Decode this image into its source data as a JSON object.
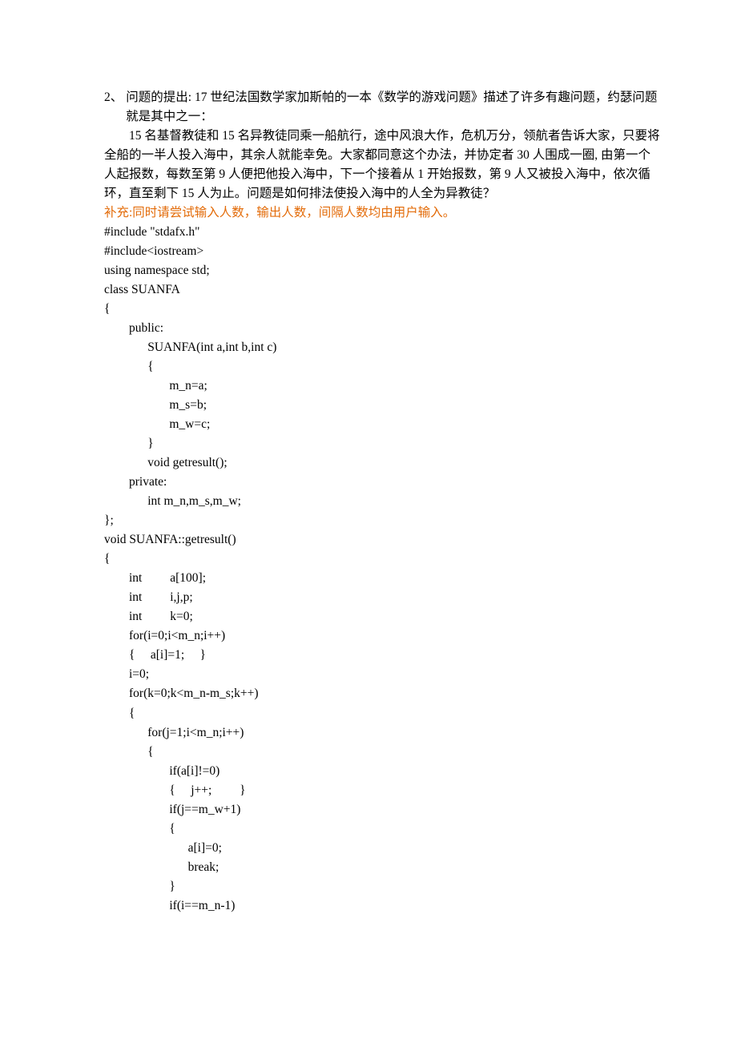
{
  "question_number": "2、",
  "title_line": "问题的提出: 17 世纪法国数学家加斯帕的一本《数学的游戏问题》描述了许多有趣问题，约瑟问题就是其中之一：",
  "para1": "15 名基督教徒和 15 名异教徒同乘一船航行，途中风浪大作，危机万分，领航者告诉大家，只要将全船的一半人投入海中，其余人就能幸免。大家都同意这个办法，并协定者 30 人围成一圈, 由第一个人起报数，每数至第 9 人便把他投入海中，下一个接着从 1 开始报数，第 9 人又被投入海中，依次循环，直至剩下 15 人为止。问题是如何排法使投入海中的人全为异教徒？",
  "supplement": "补充:同时请尝试输入人数，输出人数，间隔人数均由用户输入。",
  "code_lines": [
    "#include \"stdafx.h\"",
    "#include<iostream>",
    "using namespace std;",
    "class SUANFA",
    "{",
    "        public:",
    "              SUANFA(int a,int b,int c)",
    "              {",
    "                     m_n=a;",
    "                     m_s=b;",
    "                     m_w=c;",
    "              }",
    "              void getresult();",
    "        private:",
    "              int m_n,m_s,m_w;",
    "};",
    "void SUANFA::getresult()",
    "{",
    "        int         a[100];",
    "        int         i,j,p;",
    "        int         k=0;",
    "        for(i=0;i<m_n;i++)",
    "        {     a[i]=1;     }",
    "        i=0;",
    "        for(k=0;k<m_n-m_s;k++)",
    "        {",
    "              for(j=1;i<m_n;i++)",
    "              {",
    "                     if(a[i]!=0)",
    "                     {     j++;         }",
    "                     if(j==m_w+1)",
    "                     {",
    "                           a[i]=0;",
    "                           break;",
    "                     }",
    "                     if(i==m_n-1)"
  ]
}
